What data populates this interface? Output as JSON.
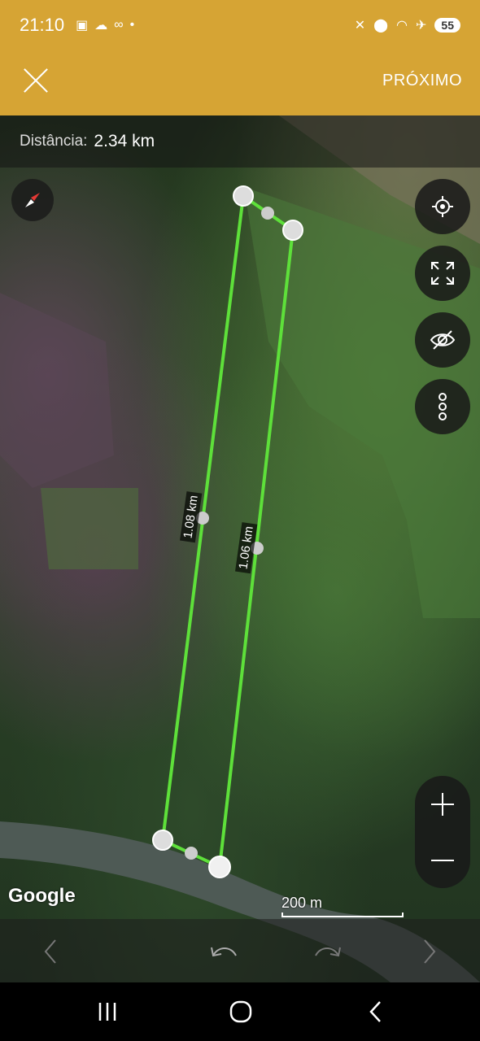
{
  "status_bar": {
    "time": "21:10",
    "battery": "55"
  },
  "header": {
    "next_label": "PRÓXIMO"
  },
  "measurement": {
    "distance_label": "Distância:",
    "distance_value": "2.34 km",
    "segment_left": "1.08 km",
    "segment_right": "1.06 km"
  },
  "map": {
    "attribution": "Google",
    "scale_label": "200 m"
  },
  "icons": [
    "compass-icon",
    "my-location-icon",
    "fullscreen-icon",
    "visibility-off-icon",
    "more-options-icon",
    "zoom-in-icon",
    "zoom-out-icon",
    "prev-icon",
    "undo-icon",
    "redo-icon",
    "next-icon"
  ],
  "colors": {
    "accent": "#d6a434",
    "measure_line": "#5ee03a"
  }
}
